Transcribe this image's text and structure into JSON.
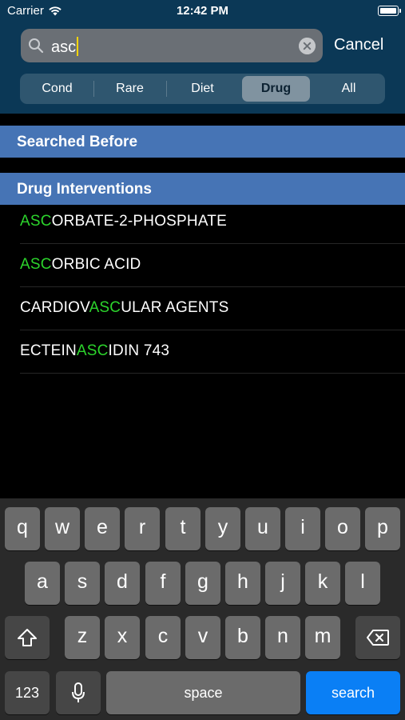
{
  "status_bar": {
    "carrier": "Carrier",
    "time": "12:42 PM"
  },
  "search": {
    "query": "asc",
    "cancel_label": "Cancel"
  },
  "segments": [
    {
      "label": "Cond",
      "selected": false
    },
    {
      "label": "Rare",
      "selected": false
    },
    {
      "label": "Diet",
      "selected": false
    },
    {
      "label": "Drug",
      "selected": true
    },
    {
      "label": "All",
      "selected": false
    }
  ],
  "sections": {
    "searched_before": "Searched Before",
    "drug_interventions": "Drug Interventions"
  },
  "results": [
    {
      "before": "",
      "match": "ASC",
      "after": "ORBATE-2-PHOSPHATE"
    },
    {
      "before": "",
      "match": "ASC",
      "after": "ORBIC ACID"
    },
    {
      "before": "CARDIOV",
      "match": "ASC",
      "after": "ULAR AGENTS"
    },
    {
      "before": "ECTEIN",
      "match": "ASC",
      "after": "IDIN 743"
    }
  ],
  "keyboard": {
    "row1": [
      "q",
      "w",
      "e",
      "r",
      "t",
      "y",
      "u",
      "i",
      "o",
      "p"
    ],
    "row2": [
      "a",
      "s",
      "d",
      "f",
      "g",
      "h",
      "j",
      "k",
      "l"
    ],
    "row3": [
      "z",
      "x",
      "c",
      "v",
      "b",
      "n",
      "m"
    ],
    "num_label": "123",
    "space_label": "space",
    "search_label": "search",
    "shift_icon": "shift-icon",
    "delete_icon": "delete-icon",
    "mic_icon": "microphone-icon"
  },
  "colors": {
    "header_bg": "#0b3856",
    "section_band": "#4674b5",
    "match_highlight": "#2cd42c",
    "search_key": "#0a7ff5"
  }
}
